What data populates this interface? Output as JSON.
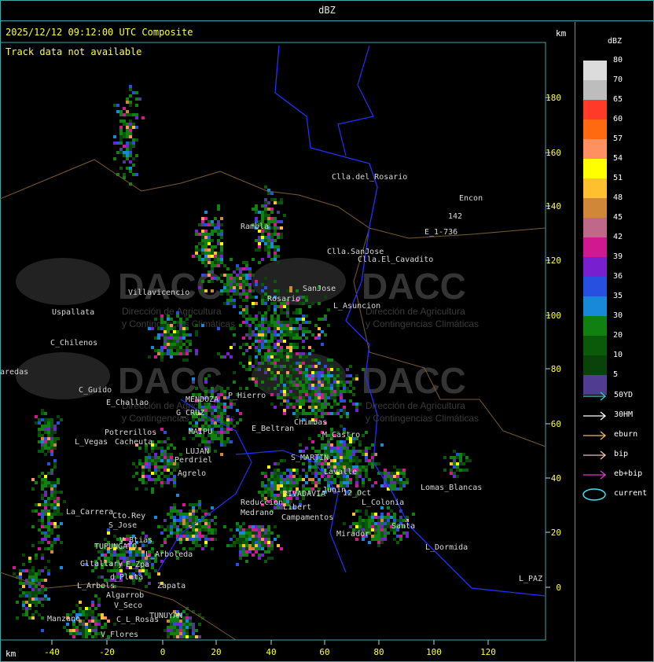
{
  "header": {
    "title": "dBZ",
    "timestamp": "2025/12/12 09:12:00 UTC Composite",
    "track_status": "Track data not available",
    "km_label": "km"
  },
  "watermark": {
    "brand": "DACC",
    "line1": "Dirección de Agricultura",
    "line2": "y Contingencias Climáticas"
  },
  "axes": {
    "x_label": "km",
    "x_ticks": [
      "-40",
      "-20",
      "0",
      "20",
      "40",
      "60",
      "80",
      "100",
      "120"
    ],
    "y_ticks": [
      "180",
      "160",
      "140",
      "120",
      "100",
      "80",
      "60",
      "40",
      "20",
      "0"
    ]
  },
  "map_labels": [
    "Clla.del_Rosario",
    "Encon",
    "142",
    "E_1-736",
    "Rambla",
    "Clla.SanJose",
    "Clla.El_Cavadito",
    "SanJose",
    "L_Asuncion",
    "Villavicencio",
    "Uspallata",
    "C_Chilenos",
    "aredas",
    "C_Guido",
    "E_Challao",
    "MENDOZA",
    "G_CRUZ",
    "Potrerillos",
    "L_Vegas",
    "Cacheuta",
    "MAIPU",
    "LUJAN",
    "Perdriel",
    "Agrelo",
    "Medrano",
    "Reduccion",
    "S_MARTIN",
    "RIVADAVIA",
    "Junin",
    "L_Colonia",
    "Lomas_Blancas",
    "La_Carrera",
    "Cto.Rey",
    "S_Jose",
    "V_Btias",
    "TUPUNGATO",
    "L_Arboleda",
    "Gltallary",
    "E_Zpa",
    "d_Plata",
    "L_Arbols",
    "Algarrob",
    "V_Seco",
    "Zapata",
    "TUNUYAN",
    "C_L_Rosas",
    "Manzano",
    "V_Flores",
    "Campamentos",
    "Mirador",
    "Santa",
    "L_Dormida",
    "L_PAZ",
    "12_Oct",
    "Libert",
    "E_Beltran",
    "Chimbas",
    "M_Castro",
    "Lavalle",
    "P_Hierro",
    "Rosario"
  ],
  "legend": {
    "title": "dBZ",
    "levels": [
      {
        "label": "80",
        "color": "#dcdcdc"
      },
      {
        "label": "70",
        "color": "#bdbdbd"
      },
      {
        "label": "65",
        "color": "#ff3a28"
      },
      {
        "label": "60",
        "color": "#ff6a10"
      },
      {
        "label": "57",
        "color": "#ff9060"
      },
      {
        "label": "54",
        "color": "#ffff00"
      },
      {
        "label": "51",
        "color": "#ffc030"
      },
      {
        "label": "48",
        "color": "#d08838"
      },
      {
        "label": "45",
        "color": "#c06888"
      },
      {
        "label": "42",
        "color": "#d01890"
      },
      {
        "label": "39",
        "color": "#7820d0"
      },
      {
        "label": "36",
        "color": "#2850e0"
      },
      {
        "label": "35",
        "color": "#1888d8"
      },
      {
        "label": "30",
        "color": "#108010"
      },
      {
        "label": "20",
        "color": "#0a5a0a"
      },
      {
        "label": "10",
        "color": "#0a430a"
      },
      {
        "label": "5",
        "color": "#503c90"
      }
    ],
    "tracks": [
      {
        "label": "50YD",
        "color": "#40c8d0",
        "shape": "arrow"
      },
      {
        "label": "30HM",
        "color": "#ffffff",
        "shape": "arrow"
      },
      {
        "label": "eburn",
        "color": "#f0b868",
        "shape": "arrow"
      },
      {
        "label": "bip",
        "color": "#f0c0b0",
        "shape": "arrow"
      },
      {
        "label": "eb+bip",
        "color": "#d838c8",
        "shape": "arrow"
      },
      {
        "label": "current",
        "color": "#40e0f0",
        "shape": "ellipse"
      }
    ]
  }
}
